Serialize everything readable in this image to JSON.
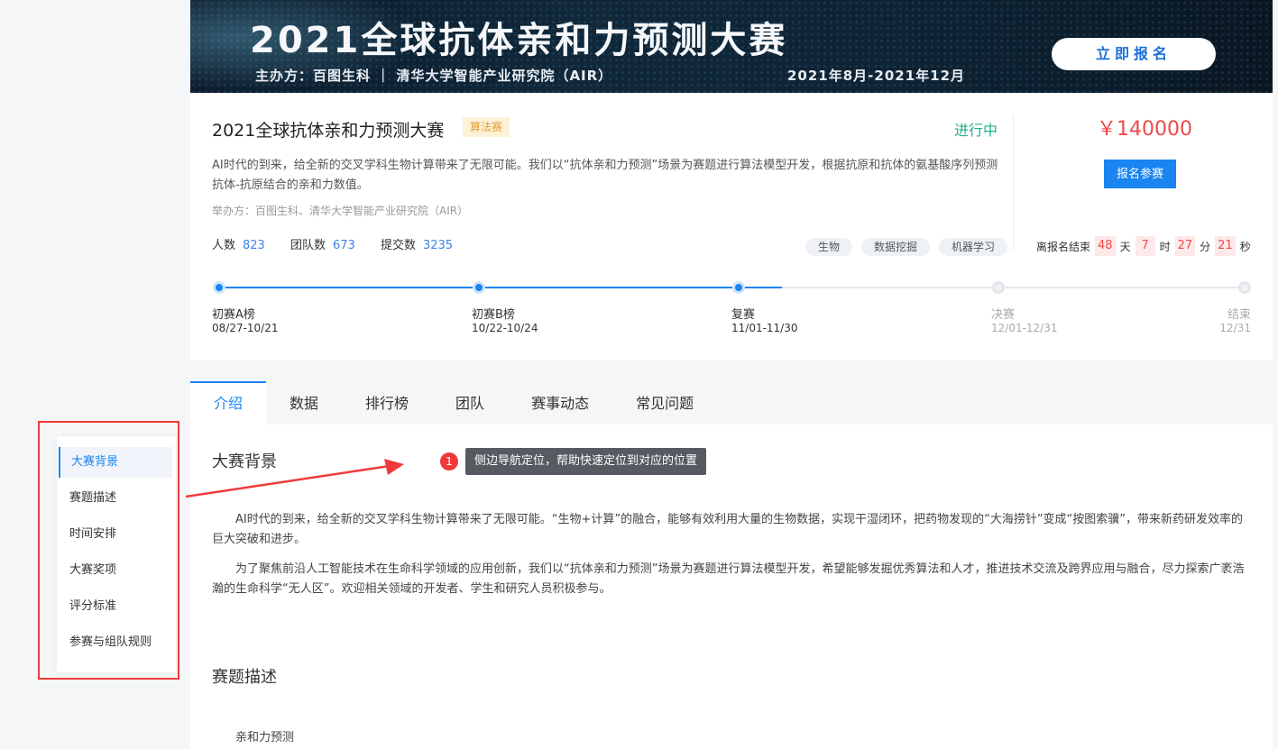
{
  "banner": {
    "title": "2021全球抗体亲和力预测大赛",
    "subtitle": "主办方：百图生科 ｜ 清华大学智能产业研究院（AIR）",
    "date_range": "2021年8月-2021年12月",
    "signup_label": "立即报名"
  },
  "competition": {
    "title": "2021全球抗体亲和力预测大赛",
    "type_badge": "算法赛",
    "status": "进行中",
    "description": "AI时代的到来，给全新的交叉学科生物计算带来了无限可能。我们以“抗体亲和力预测”场景为赛题进行算法模型开发，根据抗原和抗体的氨基酸序列预测抗体-抗原结合的亲和力数值。",
    "organizer": "举办方：百图生科、清华大学智能产业研究院（AIR）",
    "stats": {
      "people_label": "人数",
      "people": "823",
      "teams_label": "团队数",
      "teams": "673",
      "submissions_label": "提交数",
      "submissions": "3235"
    },
    "tags": [
      "生物",
      "数据挖掘",
      "机器学习"
    ],
    "prize": "￥140000",
    "signup_button": "报名参赛",
    "countdown": {
      "prefix": "离报名结束",
      "days": "48",
      "days_unit": "天",
      "hours": "7",
      "hours_unit": "时",
      "minutes": "27",
      "minutes_unit": "分",
      "seconds": "21",
      "seconds_unit": "秒"
    }
  },
  "timeline": [
    {
      "label": "初赛A榜",
      "date": "08/27-10/21",
      "state": "done"
    },
    {
      "label": "初赛B榜",
      "date": "10/22-10/24",
      "state": "done"
    },
    {
      "label": "复赛",
      "date": "11/01-11/30",
      "state": "done"
    },
    {
      "label": "决赛",
      "date": "12/01-12/31",
      "state": "todo"
    },
    {
      "label": "结束",
      "date": "12/31",
      "state": "todo"
    }
  ],
  "tabs": [
    "介绍",
    "数据",
    "排行榜",
    "团队",
    "赛事动态",
    "常见问题"
  ],
  "side_nav": [
    "大赛背景",
    "赛题描述",
    "时间安排",
    "大赛奖项",
    "评分标准",
    "参赛与组队规则"
  ],
  "content": {
    "section1_title": "大赛背景",
    "para1": "AI时代的到来，给全新的交叉学科生物计算带来了无限可能。“生物+计算”的融合，能够有效利用大量的生物数据，实现干湿闭环，把药物发现的“大海捞针”变成“按图索骥”，带来新药研发效率的巨大突破和进步。",
    "para2": "为了聚焦前沿人工智能技术在生命科学领域的应用创新，我们以“抗体亲和力预测”场景为赛题进行算法模型开发，希望能够发掘优秀算法和人才，推进技术交流及跨界应用与融合，尽力探索广袤浩瀚的生命科学“无人区”。欢迎相关领域的开发者、学生和研究人员积极参与。",
    "section2_title": "赛题描述",
    "sub_item": "亲和力预测"
  },
  "annotation": {
    "number": "1",
    "text": "侧边导航定位，帮助快速定位到对应的位置"
  },
  "colors": {
    "primary": "#1a84f1",
    "status_green": "#20b28a",
    "prize_red": "#f04848",
    "badge_bg": "#fdf1d8",
    "annotation_red": "#f03a3a"
  }
}
